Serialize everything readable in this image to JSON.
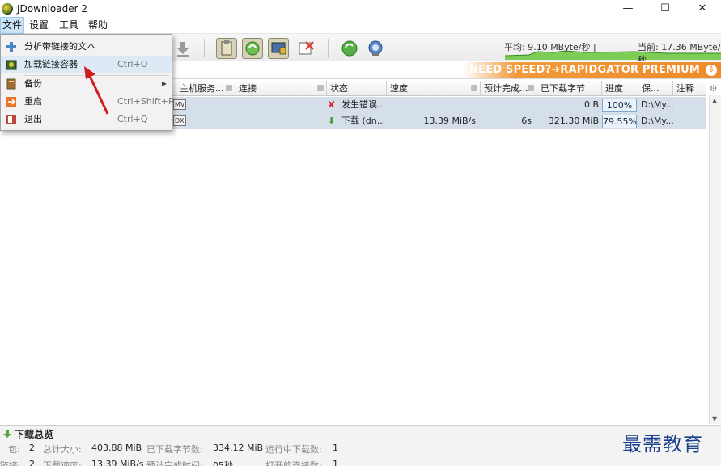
{
  "window": {
    "title": "JDownloader 2",
    "min": "—",
    "max": "☐",
    "close": "✕"
  },
  "menubar": [
    "文件",
    "设置",
    "工具",
    "帮助"
  ],
  "file_menu": [
    {
      "label": "分析带链接的文本",
      "shortcut": "",
      "icon": "plus-icon"
    },
    {
      "label": "加载链接容器",
      "shortcut": "Ctrl+O",
      "icon": "load-container-icon"
    },
    {
      "label": "备份",
      "shortcut": "",
      "icon": "backup-icon",
      "submenu": true
    },
    {
      "label": "重启",
      "shortcut": "Ctrl+Shift+R",
      "icon": "restart-icon"
    },
    {
      "label": "退出",
      "shortcut": "Ctrl+Q",
      "icon": "exit-icon"
    }
  ],
  "toolbar": {
    "icons": [
      "download-icon",
      "clipboard-icon",
      "reconnect-icon",
      "premium-icon",
      "clear-icon",
      "update-icon",
      "remote-icon"
    ]
  },
  "speed": {
    "average": "平均: 9.10 MByte/秒 |",
    "current": "当前: 17.36 MByte/秒"
  },
  "banner": {
    "text": "NEED SPEED?➔RAPIDGATOR PREMIUM",
    "arrow": "⇩"
  },
  "columns": [
    "主机服务...",
    "连接",
    "状态",
    "速度",
    "预计完成...",
    "已下载字节",
    "进度",
    "保...",
    "注释"
  ],
  "rows": [
    {
      "hoster": "MV",
      "status": "发生错误...",
      "status_icon": "error-icon",
      "speed": "",
      "eta": "",
      "loaded": "0 B",
      "progress": "100%",
      "progress_value": 100,
      "save": "D:\\My..."
    },
    {
      "hoster": "DX",
      "status": "下载 (dn...",
      "status_icon": "download-arrow-icon",
      "speed": "13.39 MiB/s",
      "eta": "6s",
      "loaded": "321.30 MiB",
      "progress": "79.55%",
      "progress_value": 79.55,
      "save": "D:\\My..."
    }
  ],
  "summary": {
    "title": "下载总览",
    "line1": [
      {
        "label": "包:",
        "value": "2"
      },
      {
        "label": "总计大小:",
        "value": "403.88 MiB"
      },
      {
        "label": "已下载字节数:",
        "value": "334.12 MiB"
      },
      {
        "label": "运行中下载数:",
        "value": "1"
      }
    ],
    "line2": [
      {
        "label": "链接:",
        "value": "2"
      },
      {
        "label": "下载速度:",
        "value": "13.39 MiB/s"
      },
      {
        "label": "预计完成时间:",
        "value": "05秒"
      },
      {
        "label": "打开的连接数:",
        "value": "1"
      }
    ]
  },
  "watermark": "最需教育",
  "colors": {
    "accent_orange": "#ef8a2a",
    "row_bg": "#d4dfe9",
    "menu_highlight": "#cce4f7",
    "arrow_red": "#d21b1b"
  }
}
